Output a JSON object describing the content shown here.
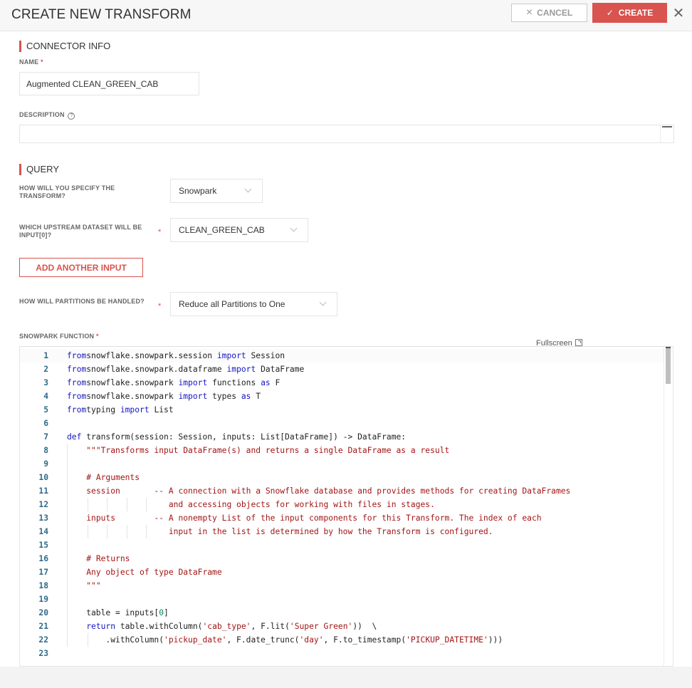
{
  "header": {
    "title": "CREATE NEW TRANSFORM",
    "cancel_label": "CANCEL",
    "create_label": "CREATE",
    "close_glyph": "✕",
    "cancel_icon": "×",
    "create_icon": "✓"
  },
  "connector_info": {
    "section_title": "CONNECTOR INFO",
    "name_label": "NAME",
    "name_value": "Augmented CLEAN_GREEN_CAB",
    "description_label": "DESCRIPTION",
    "description_value": "",
    "help_glyph": "?"
  },
  "query": {
    "section_title": "QUERY",
    "specify_label": "HOW WILL YOU SPECIFY THE TRANSFORM?",
    "specify_value": "Snowpark",
    "upstream_label": "WHICH UPSTREAM DATASET WILL BE INPUT[0]?",
    "upstream_value": "CLEAN_GREEN_CAB",
    "add_input_label": "ADD ANOTHER INPUT",
    "partitions_label": "HOW WILL PARTITIONS BE HANDLED?",
    "partitions_value": "Reduce all Partitions to One",
    "function_label": "SNOWPARK FUNCTION",
    "required_mark": "*"
  },
  "editor": {
    "fullscreen_label": "Fullscreen",
    "lines": [
      {
        "n": "1",
        "tokens": [
          [
            "kw",
            "from"
          ],
          [
            "",
            "snowflake.snowpark.session "
          ],
          [
            "kw",
            "import"
          ],
          [
            "",
            " Session"
          ]
        ]
      },
      {
        "n": "2",
        "tokens": [
          [
            "kw",
            "from"
          ],
          [
            "",
            "snowflake.snowpark.dataframe "
          ],
          [
            "kw",
            "import"
          ],
          [
            "",
            " DataFrame"
          ]
        ]
      },
      {
        "n": "3",
        "tokens": [
          [
            "kw",
            "from"
          ],
          [
            "",
            "snowflake.snowpark "
          ],
          [
            "kw",
            "import"
          ],
          [
            "",
            " functions "
          ],
          [
            "kw",
            "as"
          ],
          [
            "",
            " F"
          ]
        ]
      },
      {
        "n": "4",
        "tokens": [
          [
            "kw",
            "from"
          ],
          [
            "",
            "snowflake.snowpark "
          ],
          [
            "kw",
            "import"
          ],
          [
            "",
            " types "
          ],
          [
            "kw",
            "as"
          ],
          [
            "",
            " T"
          ]
        ]
      },
      {
        "n": "5",
        "tokens": [
          [
            "kw",
            "from"
          ],
          [
            "",
            "typing "
          ],
          [
            "kw",
            "import"
          ],
          [
            "",
            " List"
          ]
        ]
      },
      {
        "n": "6",
        "tokens": []
      },
      {
        "n": "7",
        "tokens": [
          [
            "kw",
            "def"
          ],
          [
            "",
            " transform(session: Session, inputs: List[DataFrame]) -> DataFrame:"
          ]
        ]
      },
      {
        "n": "8",
        "tokens": [
          [
            "",
            "    "
          ],
          [
            "st",
            "\"\"\"Transforms input DataFrame(s) and returns a single DataFrame as a result"
          ]
        ]
      },
      {
        "n": "9",
        "tokens": []
      },
      {
        "n": "10",
        "tokens": [
          [
            "",
            "    "
          ],
          [
            "st",
            "# Arguments"
          ]
        ]
      },
      {
        "n": "11",
        "tokens": [
          [
            "",
            "    "
          ],
          [
            "st",
            "session       -- A connection with a Snowflake database and provides methods for creating DataFrames"
          ]
        ]
      },
      {
        "n": "12",
        "tokens": [
          [
            "",
            "                     "
          ],
          [
            "st",
            "and accessing objects for working with files in stages."
          ]
        ]
      },
      {
        "n": "13",
        "tokens": [
          [
            "",
            "    "
          ],
          [
            "st",
            "inputs        -- A nonempty List of the input components for this Transform. The index of each"
          ]
        ]
      },
      {
        "n": "14",
        "tokens": [
          [
            "",
            "                     "
          ],
          [
            "st",
            "input in the list is determined by how the Transform is configured."
          ]
        ]
      },
      {
        "n": "15",
        "tokens": []
      },
      {
        "n": "16",
        "tokens": [
          [
            "",
            "    "
          ],
          [
            "st",
            "# Returns"
          ]
        ]
      },
      {
        "n": "17",
        "tokens": [
          [
            "",
            "    "
          ],
          [
            "st",
            "Any object of type DataFrame"
          ]
        ]
      },
      {
        "n": "18",
        "tokens": [
          [
            "",
            "    "
          ],
          [
            "st",
            "\"\"\""
          ]
        ]
      },
      {
        "n": "19",
        "tokens": []
      },
      {
        "n": "20",
        "tokens": [
          [
            "",
            "    table = inputs["
          ],
          [
            "nm",
            "0"
          ],
          [
            "",
            "]"
          ]
        ]
      },
      {
        "n": "21",
        "tokens": [
          [
            "",
            "    "
          ],
          [
            "kw",
            "return"
          ],
          [
            "",
            " table.withColumn("
          ],
          [
            "st",
            "'cab_type'"
          ],
          [
            "",
            ", F.lit("
          ],
          [
            "st",
            "'Super Green'"
          ],
          [
            "",
            "))  \\"
          ]
        ]
      },
      {
        "n": "22",
        "tokens": [
          [
            "",
            "        .withColumn("
          ],
          [
            "st",
            "'pickup_date'"
          ],
          [
            "",
            ", F.date_trunc("
          ],
          [
            "st",
            "'day'"
          ],
          [
            "",
            ", F.to_timestamp("
          ],
          [
            "st",
            "'PICKUP_DATETIME'"
          ],
          [
            "",
            ")))"
          ]
        ]
      },
      {
        "n": "23",
        "tokens": []
      }
    ]
  },
  "colors": {
    "accent": "#d9534f",
    "keyword": "#1414c4",
    "string": "#a31515",
    "line_number": "#2f6a8a"
  }
}
